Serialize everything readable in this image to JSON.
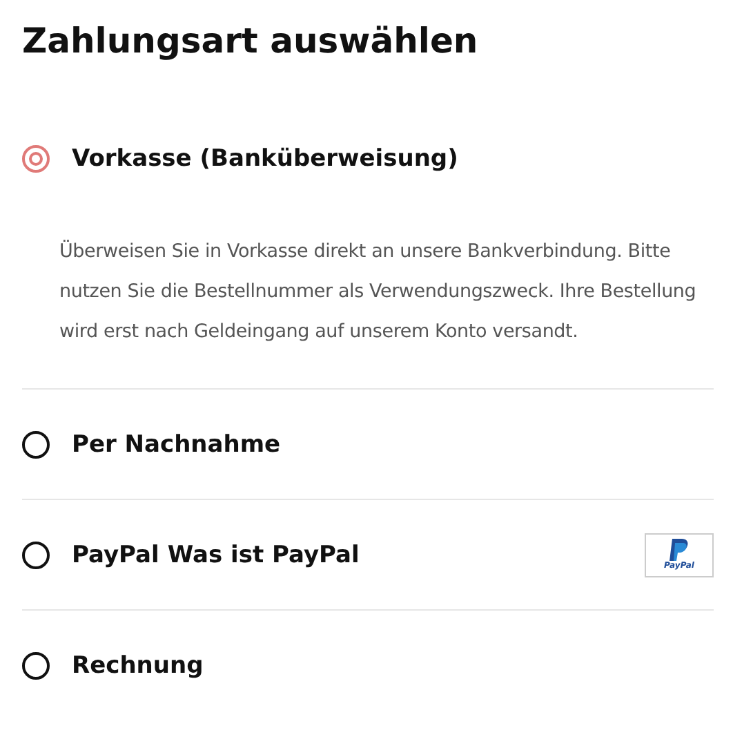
{
  "title": "Zahlungsart auswählen",
  "options": [
    {
      "label": "Vorkasse (Banküberweisung)",
      "selected": true,
      "description": "Überweisen Sie in Vorkasse direkt an unsere Bankverbindung. Bitte nutzen Sie die Bestellnummer als Verwendungszweck. Ihre Bestellung wird erst nach Geldeingang auf unserem Konto versandt."
    },
    {
      "label": "Per Nachnahme",
      "selected": false
    },
    {
      "label": "PayPal",
      "link": "Was ist PayPal",
      "logo_text": "PayPal",
      "selected": false
    },
    {
      "label": "Rechnung",
      "selected": false
    }
  ]
}
